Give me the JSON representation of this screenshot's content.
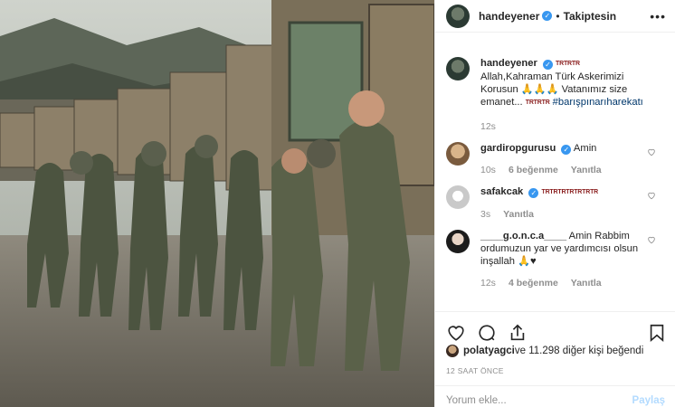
{
  "header": {
    "username": "handeyener",
    "verified_mark": "✓",
    "separator": "•",
    "follow_label": "Takiptesin",
    "more_label": "•••"
  },
  "caption": {
    "username": "handeyener",
    "flag_text": "TRTRTR",
    "text": "Allah,Kahraman Türk Askerimizi Korusun 🙏🙏🙏 Vatanımız size emanet...",
    "flag_text2": "TRTRTR",
    "hashtag": "#barışpınarıharekatı",
    "time": "12s"
  },
  "comments": [
    {
      "username": "gardiropgurusu",
      "text": "Amin",
      "time": "10s",
      "likes": "6 beğenme",
      "reply": "Yanıtla",
      "avatar_color": "#c2a27a"
    },
    {
      "username": "safakcak",
      "text": "TRTRTRTRTRTRTR",
      "time": "3s",
      "likes": "",
      "reply": "Yanıtla",
      "avatar_color": "#dcdcdc"
    },
    {
      "username": "____g.o.n.c.a____",
      "text": "Amin Rabbim ordumuzun yar ve yardımcısı olsun inşallah 🙏♥",
      "time": "12s",
      "likes": "4 beğenme",
      "reply": "Yanıtla",
      "avatar_color": "#1c1c1c"
    }
  ],
  "actions": {
    "like_icon": "heart-icon",
    "comment_icon": "comment-icon",
    "share_icon": "share-icon",
    "save_icon": "bookmark-icon"
  },
  "likes": {
    "liker": "polatyagci",
    "rest": " ve 11.298 diğer kişi beğendi"
  },
  "timestamp": "12 SAAT ÖNCE",
  "add_comment": {
    "placeholder": "Yorum ekle...",
    "post_label": "Paylaş"
  },
  "colors": {
    "verified": "#3897f0",
    "hashtag": "#00376b",
    "muted": "#8e8e8e",
    "post_button": "#b3dbff"
  }
}
